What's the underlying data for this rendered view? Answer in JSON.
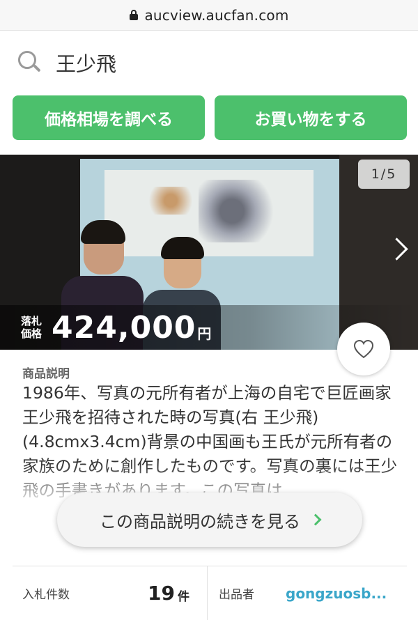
{
  "browser": {
    "url": "aucview.aucfan.com"
  },
  "search": {
    "query": "王少飛"
  },
  "actions": {
    "market_label": "価格相場を調べる",
    "shop_label": "お買い物をする"
  },
  "photo": {
    "counter": "1/5",
    "price_label_line1": "落札",
    "price_label_line2": "価格",
    "price": "424,000",
    "price_unit": "円"
  },
  "description": {
    "title": "商品説明",
    "body": "1986年、写真の元所有者が上海の自宅で巨匠画家王少飛を招待された時の写真(右 王少飛)(4.8cmx3.4cm)背景の中国画も王氏が元所有者の家族のために創作したものです。写真の裏には王少飛の手書きがあります。この写真は、",
    "more_label": "この商品説明の続きを見る"
  },
  "stats": {
    "bids_label": "入札件数",
    "bids_value": "19",
    "bids_unit": "件",
    "seller_label": "出品者",
    "seller_value": "gongzuosb..."
  },
  "colors": {
    "accent": "#4cc06c",
    "link": "#3aa6c9"
  }
}
